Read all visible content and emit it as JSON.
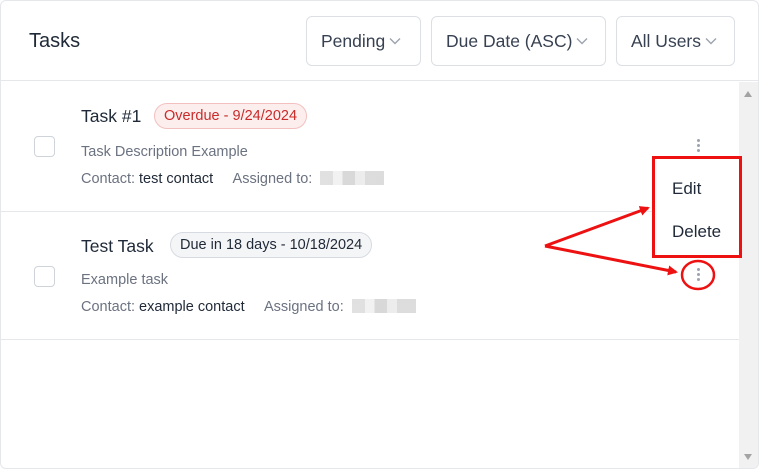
{
  "header": {
    "title": "Tasks",
    "filters": [
      {
        "label": "Pending"
      },
      {
        "label": "Due Date (ASC)"
      },
      {
        "label": "All Users"
      }
    ]
  },
  "tasks": [
    {
      "name": "Task #1",
      "badge": "Overdue - 9/24/2024",
      "badge_status": "overdue",
      "description": "Task Description Example",
      "contact_label": "Contact:",
      "contact": "test contact",
      "assigned_label": "Assigned to:"
    },
    {
      "name": "Test Task",
      "badge": "Due in 18 days - 10/18/2024",
      "badge_status": "due",
      "description": "Example task",
      "contact_label": "Contact:",
      "contact": "example contact",
      "assigned_label": "Assigned to:"
    }
  ],
  "context_menu": {
    "items": [
      {
        "label": "Edit"
      },
      {
        "label": "Delete"
      }
    ]
  },
  "colors": {
    "overdue_text": "#c92a2a",
    "overdue_bg": "#fdeeee",
    "annotation": "#ee1111"
  },
  "icons": [
    "chevron-down-icon",
    "more-vertical-icon",
    "scroll-up-icon",
    "scroll-down-icon"
  ]
}
